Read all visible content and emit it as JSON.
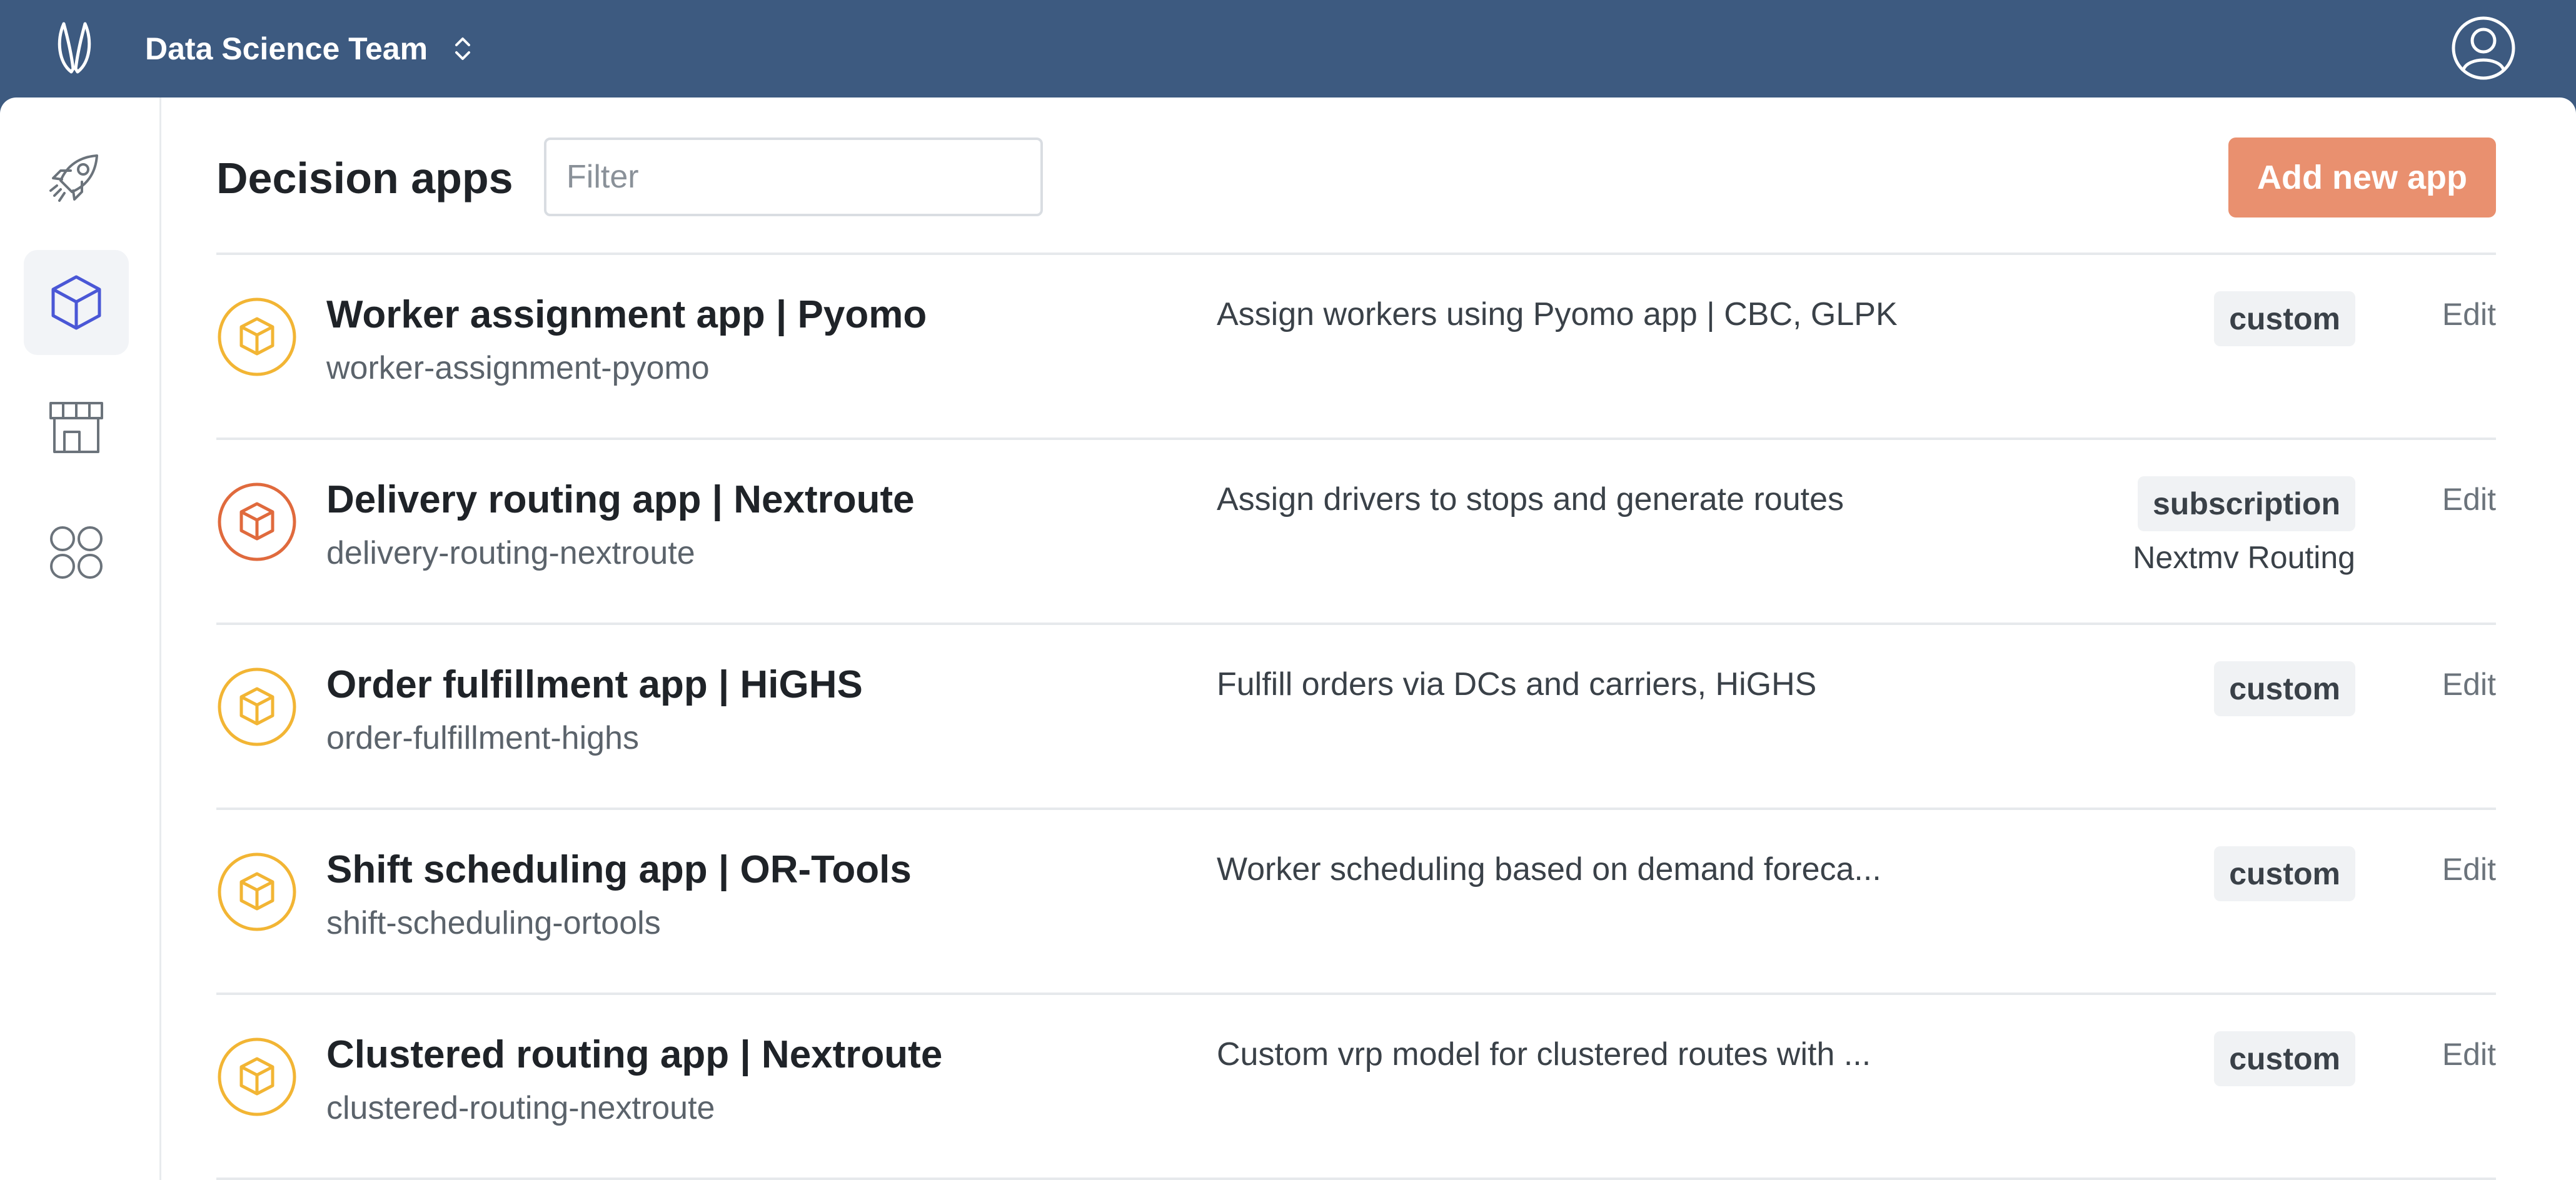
{
  "header": {
    "team_name": "Data Science Team",
    "logo_icon": "rabbit-ears-logo",
    "switch_icon": "chevron-up-down-icon",
    "avatar_icon": "user-circle-icon",
    "background_color": "#3d5a80"
  },
  "sidebar": {
    "items": [
      {
        "icon": "rocket-icon",
        "active": false
      },
      {
        "icon": "cube-icon",
        "active": true
      },
      {
        "icon": "storefront-icon",
        "active": false
      },
      {
        "icon": "apps-grid-icon",
        "active": false
      }
    ]
  },
  "main": {
    "title": "Decision apps",
    "filter_placeholder": "Filter",
    "filter_value": "",
    "add_button_label": "Add new app",
    "accent_color": "#e9906f",
    "apps": [
      {
        "name": "Worker assignment app | Pyomo",
        "slug": "worker-assignment-pyomo",
        "description": "Assign workers using Pyomo app | CBC, GLPK",
        "tag": "custom",
        "tag_sub": "",
        "edit_label": "Edit",
        "icon_color": "#f2b534"
      },
      {
        "name": "Delivery routing app | Nextroute",
        "slug": "delivery-routing-nextroute",
        "description": "Assign drivers to stops and generate routes",
        "tag": "subscription",
        "tag_sub": "Nextmv Routing",
        "edit_label": "Edit",
        "icon_color": "#e06a3d"
      },
      {
        "name": "Order fulfillment app | HiGHS",
        "slug": "order-fulfillment-highs",
        "description": "Fulfill orders via DCs and carriers, HiGHS",
        "tag": "custom",
        "tag_sub": "",
        "edit_label": "Edit",
        "icon_color": "#f2b534"
      },
      {
        "name": "Shift scheduling app | OR-Tools",
        "slug": "shift-scheduling-ortools",
        "description": "Worker scheduling based on demand foreca...",
        "tag": "custom",
        "tag_sub": "",
        "edit_label": "Edit",
        "icon_color": "#f2b534"
      },
      {
        "name": "Clustered routing app | Nextroute",
        "slug": "clustered-routing-nextroute",
        "description": "Custom vrp model for clustered routes with ...",
        "tag": "custom",
        "tag_sub": "",
        "edit_label": "Edit",
        "icon_color": "#f2b534"
      }
    ]
  }
}
